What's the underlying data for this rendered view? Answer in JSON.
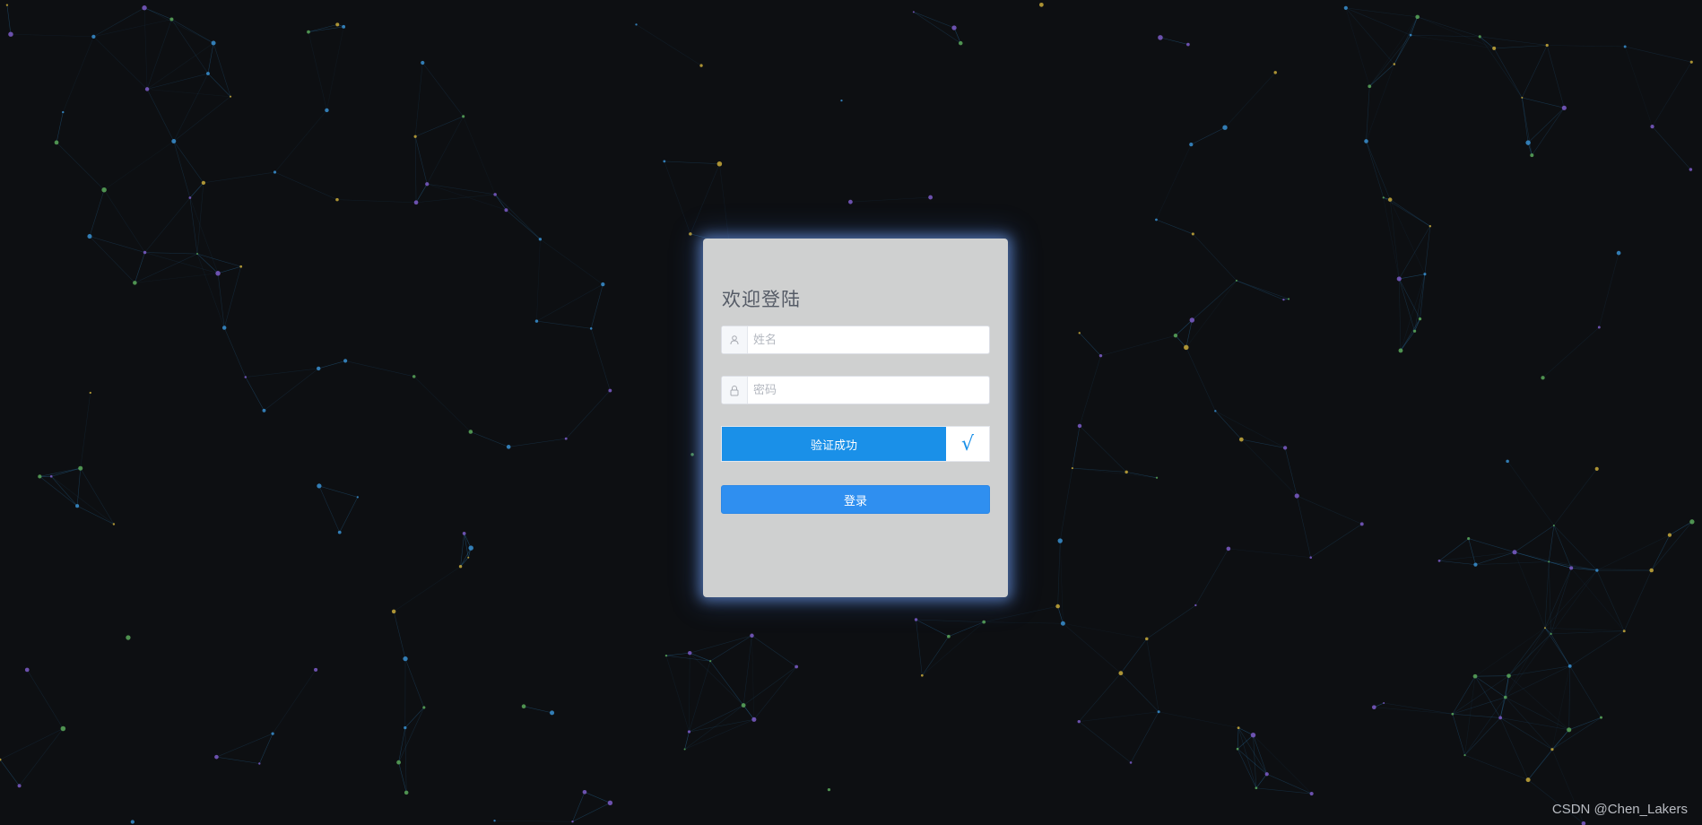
{
  "login": {
    "title": "欢迎登陆",
    "name_placeholder": "姓名",
    "password_placeholder": "密码",
    "verify_text": "验证成功",
    "verify_mark": "√",
    "submit_label": "登录"
  },
  "watermark": "CSDN @Chen_Lakers",
  "icons": {
    "name": "user-icon",
    "password": "lock-icon"
  },
  "colors": {
    "background": "#0d0f12",
    "card": "#cfd0d0",
    "accent": "#1a90e8",
    "button": "#2f8ff0",
    "particle_colors": [
      "#3a8fd0",
      "#c8a93a",
      "#7c5cc8",
      "#5aa85a"
    ]
  }
}
